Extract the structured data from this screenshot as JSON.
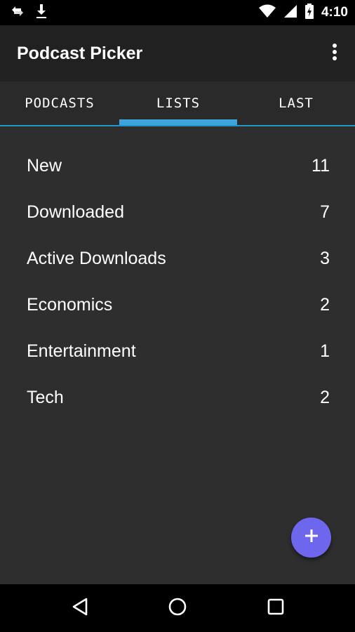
{
  "status_bar": {
    "time": "4:10",
    "icons": [
      "sync-icon",
      "download-icon",
      "wifi-icon",
      "signal-icon",
      "battery-charging-icon"
    ]
  },
  "app_bar": {
    "title": "Podcast Picker",
    "overflow_icon": "more-vert-icon"
  },
  "tabs": [
    {
      "label": "PODCASTS",
      "selected": false
    },
    {
      "label": "LISTS",
      "selected": true
    },
    {
      "label": "LAST",
      "selected": false
    }
  ],
  "lists": [
    {
      "label": "New",
      "count": "11"
    },
    {
      "label": "Downloaded",
      "count": "7"
    },
    {
      "label": "Active Downloads",
      "count": "3"
    },
    {
      "label": "Economics",
      "count": "2"
    },
    {
      "label": "Entertainment",
      "count": "1"
    },
    {
      "label": "Tech",
      "count": "2"
    }
  ],
  "fab": {
    "icon": "plus-icon"
  },
  "nav_bar": {
    "icons": [
      "back-icon",
      "home-icon",
      "recents-icon"
    ]
  },
  "colors": {
    "accent": "#3aa6dc",
    "fab": "#6f66ee",
    "app_bar": "#212121",
    "background": "#2e2e2e"
  }
}
